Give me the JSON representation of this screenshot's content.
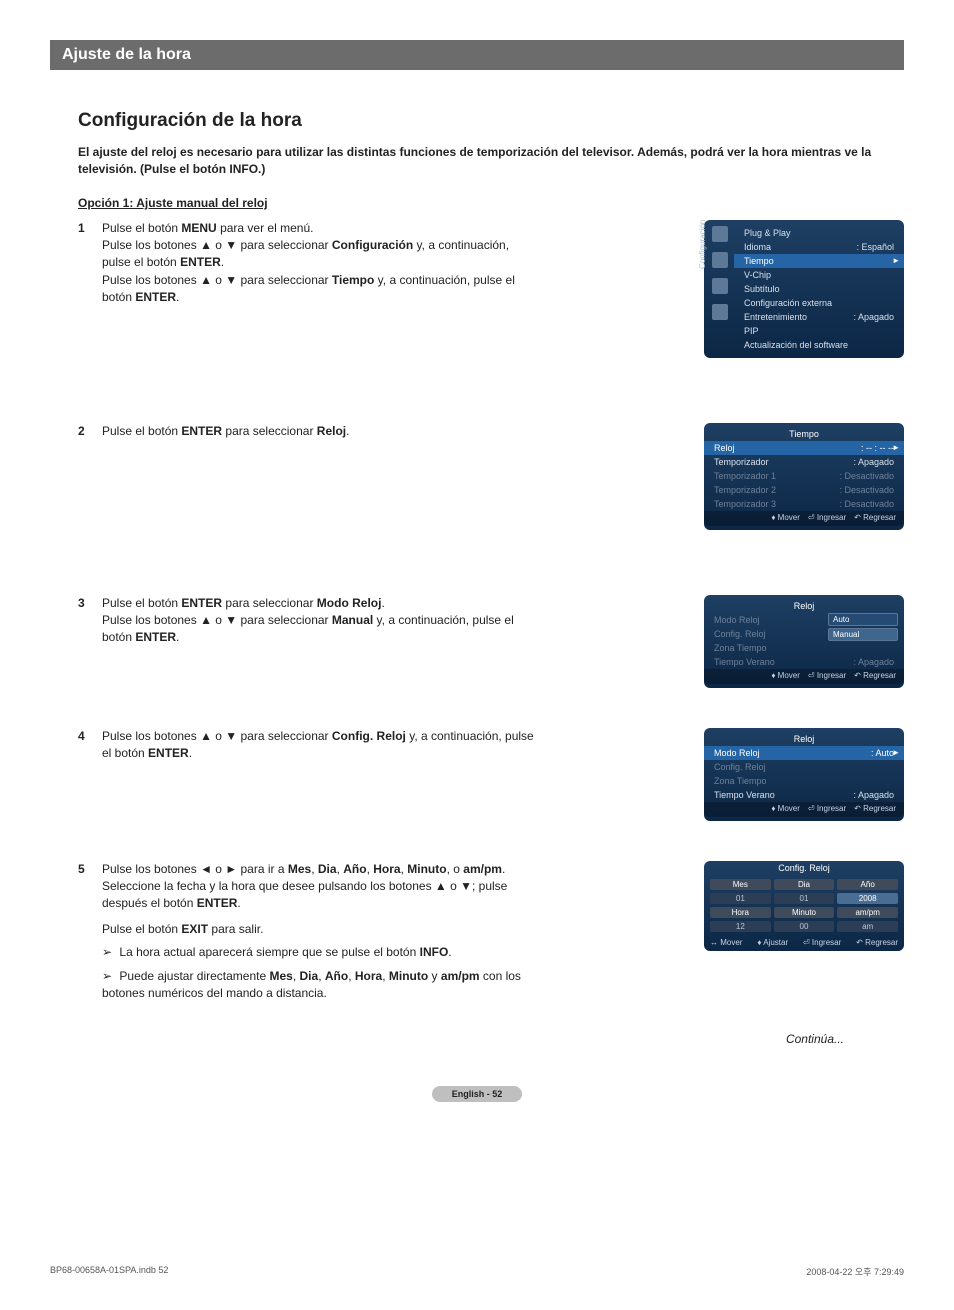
{
  "section_bar": "Ajuste de la hora",
  "title": "Configuración de la hora",
  "intro": "El ajuste del reloj es necesario para utilizar las distintas funciones de temporización del televisor. Además, podrá ver la hora mientras ve la televisión. (Pulse el botón INFO.)",
  "option1_heading": "Opción 1: Ajuste manual del reloj",
  "steps": {
    "s1": {
      "num": "1",
      "p1a": "Pulse el botón ",
      "p1b": "MENU",
      "p1c": " para ver el menú.",
      "p2a": "Pulse los botones ▲ o ▼ para seleccionar ",
      "p2b": "Configuración",
      "p2c": " y, a continuación, pulse el botón ",
      "p2d": "ENTER",
      "p2e": ".",
      "p3a": "Pulse los botones ▲ o ▼ para seleccionar ",
      "p3b": "Tiempo",
      "p3c": " y, a continuación, pulse el botón ",
      "p3d": "ENTER",
      "p3e": "."
    },
    "s2": {
      "num": "2",
      "p1a": "Pulse el botón ",
      "p1b": "ENTER",
      "p1c": " para seleccionar ",
      "p1d": "Reloj",
      "p1e": "."
    },
    "s3": {
      "num": "3",
      "p1a": "Pulse el botón ",
      "p1b": "ENTER",
      "p1c": " para seleccionar ",
      "p1d": "Modo Reloj",
      "p1e": ".",
      "p2a": "Pulse los botones ▲ o ▼ para seleccionar ",
      "p2b": "Manual",
      "p2c": " y, a continuación, pulse el botón ",
      "p2d": "ENTER",
      "p2e": "."
    },
    "s4": {
      "num": "4",
      "p1a": "Pulse los botones ▲ o ▼ para seleccionar ",
      "p1b": "Config. Reloj",
      "p1c": " y, a continuación, pulse el botón ",
      "p1d": "ENTER",
      "p1e": "."
    },
    "s5": {
      "num": "5",
      "p1a": "Pulse los botones ◄ o ► para ir a ",
      "p1_parts": [
        "Mes",
        ", ",
        "Dia",
        ", ",
        "Año",
        ", ",
        "Hora",
        ", ",
        "Minuto",
        ", o ",
        "am/pm",
        "."
      ],
      "p2a": "Seleccione la fecha y la hora que desee pulsando los botones ▲ o ▼; pulse después el botón ",
      "p2b": "ENTER",
      "p2c": ".",
      "p3a": "Pulse el botón ",
      "p3b": "EXIT",
      "p3c": " para salir.",
      "n1a": "La hora actual aparecerá siempre que se pulse el botón ",
      "n1b": "INFO",
      "n1c": ".",
      "n2a": "Puede ajustar directamente ",
      "n2_parts": [
        "Mes",
        ", ",
        "Dia",
        ", ",
        "Año",
        ", ",
        "Hora",
        ", ",
        "Minuto",
        " y ",
        "am/pm"
      ],
      "n2b": " con los botones numéricos del mando a distancia."
    }
  },
  "osd1": {
    "side_label": "Configuración",
    "items": [
      {
        "l": "Plug & Play",
        "r": ""
      },
      {
        "l": "Idioma",
        "r": ": Español"
      },
      {
        "l": "Tiempo",
        "r": "",
        "sel": true
      },
      {
        "l": "V-Chip",
        "r": ""
      },
      {
        "l": "Subtítulo",
        "r": ""
      },
      {
        "l": "Configuración externa",
        "r": ""
      },
      {
        "l": "Entretenimiento",
        "r": ": Apagado"
      },
      {
        "l": "PIP",
        "r": ""
      },
      {
        "l": "Actualización del software",
        "r": ""
      }
    ]
  },
  "osd2": {
    "hdr": "Tiempo",
    "items": [
      {
        "l": "Reloj",
        "r": ": -- : -- --",
        "sel": true
      },
      {
        "l": "Temporizador",
        "r": ": Apagado"
      },
      {
        "l": "Temporizador 1",
        "r": ": Desactivado",
        "dim": true
      },
      {
        "l": "Temporizador 2",
        "r": ": Desactivado",
        "dim": true
      },
      {
        "l": "Temporizador 3",
        "r": ": Desactivado",
        "dim": true
      }
    ],
    "ftr": [
      "♦ Mover",
      "⏎ Ingresar",
      "↶ Regresar"
    ]
  },
  "osd3": {
    "hdr": "Reloj",
    "items": [
      {
        "l": "Modo Reloj",
        "r": "",
        "dim": true
      },
      {
        "l": "Config. Reloj",
        "r": "",
        "dim": true
      },
      {
        "l": "Zona Tiempo",
        "r": "",
        "dim": true
      },
      {
        "l": "Tiempo Verano",
        "r": ": Apagado",
        "dim": true
      }
    ],
    "opts": [
      "Auto",
      "Manual"
    ],
    "ftr": [
      "♦ Mover",
      "⏎ Ingresar",
      "↶ Regresar"
    ]
  },
  "osd4": {
    "hdr": "Reloj",
    "items": [
      {
        "l": "Modo Reloj",
        "r": ": Auto",
        "sel": true
      },
      {
        "l": "Config. Reloj",
        "r": "",
        "dim": true
      },
      {
        "l": "Zona Tiempo",
        "r": "",
        "dim": true
      },
      {
        "l": "Tiempo Verano",
        "r": ": Apagado"
      }
    ],
    "ftr": [
      "♦ Mover",
      "⏎ Ingresar",
      "↶ Regresar"
    ]
  },
  "osd5": {
    "hdr": "Config. Reloj",
    "labels": [
      "Mes",
      "Dia",
      "Año",
      "Hora",
      "Minuto",
      "am/pm"
    ],
    "values": [
      "01",
      "01",
      "2008",
      "12",
      "00",
      "am"
    ],
    "ftr": [
      "↔ Mover",
      "♦ Ajustar",
      "⏎ Ingresar",
      "↶ Regresar"
    ]
  },
  "continues": "Continúa...",
  "page_pill": "English - 52",
  "footer_left": "BP68-00658A-01SPA.indb   52",
  "footer_right": "2008-04-22   오후 7:29:49"
}
